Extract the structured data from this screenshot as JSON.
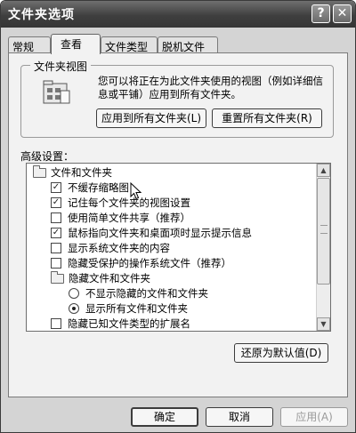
{
  "window": {
    "title": "文件夹选项",
    "help_glyph": "?",
    "close_glyph": "✕"
  },
  "tabs": [
    {
      "label": "常规"
    },
    {
      "label": "查看"
    },
    {
      "label": "文件类型"
    },
    {
      "label": "脱机文件"
    }
  ],
  "folder_views": {
    "title": "文件夹视图",
    "description": "您可以将正在为此文件夹使用的视图（例如详细信息或平铺）应用到所有文件夹。",
    "apply_all_label": "应用到所有文件夹(L)",
    "reset_all_label": "重置所有文件夹(R)"
  },
  "advanced": {
    "label": "高级设置：",
    "items": [
      {
        "kind": "folder",
        "label": "文件和文件夹"
      },
      {
        "kind": "checkbox",
        "checked": true,
        "label": "不缓存缩略图"
      },
      {
        "kind": "checkbox",
        "checked": true,
        "label": "记住每个文件夹的视图设置"
      },
      {
        "kind": "checkbox",
        "checked": false,
        "label": "使用简单文件共享（推荐）"
      },
      {
        "kind": "checkbox",
        "checked": true,
        "label": "鼠标指向文件夹和桌面项时显示提示信息"
      },
      {
        "kind": "checkbox",
        "checked": false,
        "label": "显示系统文件夹的内容"
      },
      {
        "kind": "checkbox",
        "checked": false,
        "label": "隐藏受保护的操作系统文件（推荐）"
      },
      {
        "kind": "folder",
        "label": "隐藏文件和文件夹"
      },
      {
        "kind": "radio",
        "selected": false,
        "label": "不显示隐藏的文件和文件夹"
      },
      {
        "kind": "radio",
        "selected": true,
        "label": "显示所有文件和文件夹"
      },
      {
        "kind": "checkbox",
        "checked": false,
        "label": "隐藏已知文件类型的扩展名"
      }
    ],
    "restore_defaults_label": "还原为默认值(D)"
  },
  "footer": {
    "ok_label": "确定",
    "cancel_label": "取消",
    "apply_label": "应用(A)"
  },
  "colors": {
    "titlebar": "#4a4a4a",
    "dialog_bg": "#f2f2f2",
    "disabled_text": "#9a9a9a"
  }
}
